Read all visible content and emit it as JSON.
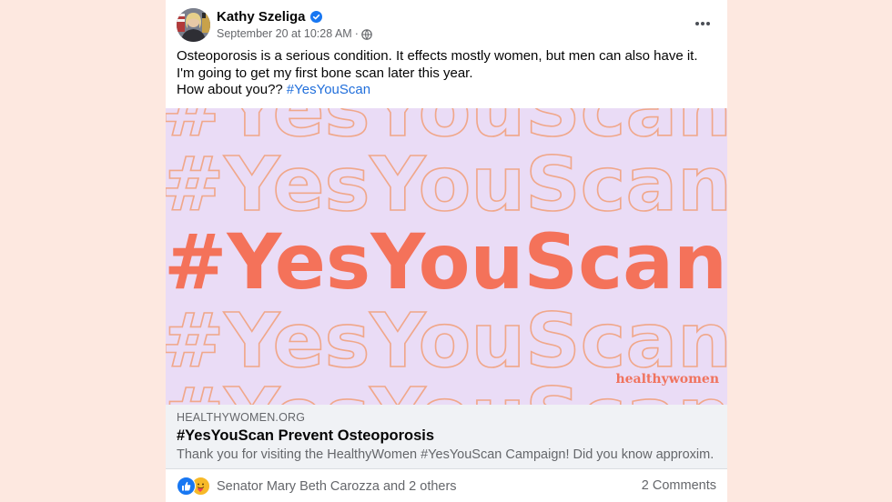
{
  "post": {
    "author_name": "Kathy Szeliga",
    "timestamp": "September 20 at 10:28 AM",
    "separator": "·",
    "text_lines": [
      "Osteoporosis is a serious condition. It effects mostly women, but men can also have it.",
      "I'm going to get my first bone scan later this year.",
      "How about you??"
    ],
    "hashtag": "#YesYouScan"
  },
  "image": {
    "pattern_text": "#YesYouScan",
    "headline": "#YesYouScan",
    "brand": "healthywomen",
    "colors": {
      "background": "#eadcf6",
      "outline": "#f0a78a",
      "headline": "#f4725a",
      "brand": "#f0735e"
    }
  },
  "link_preview": {
    "domain": "HEALTHYWOMEN.ORG",
    "title": "#YesYouScan Prevent Osteoporosis",
    "description": "Thank you for visiting the HealthyWomen #YesYouScan Campaign! Did you know approxim..."
  },
  "engagement": {
    "reaction_icons": [
      "like-icon",
      "care-icon"
    ],
    "reactors": "Senator Mary Beth Carozza and 2 others",
    "comments": "2 Comments"
  },
  "colors": {
    "page_background": "#fde8e0",
    "card_background": "#ffffff",
    "link_blue": "#216fdb",
    "verified_blue": "#1877f2",
    "secondary_text": "#65676b"
  }
}
